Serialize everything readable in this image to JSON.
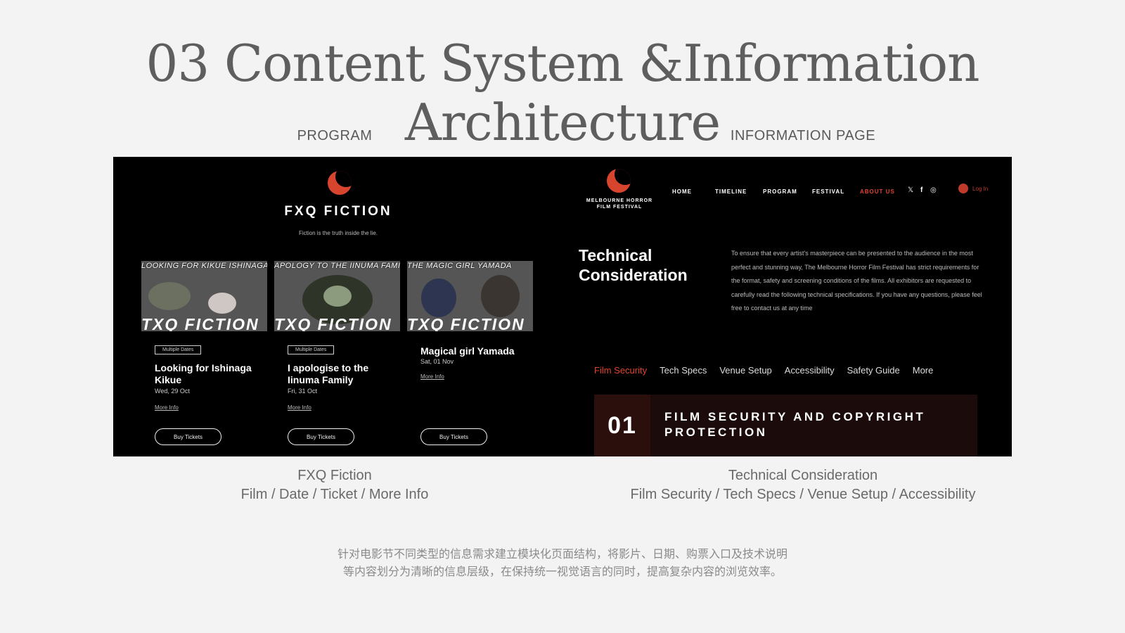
{
  "slide": {
    "title": "03 Content System &Information Architecture",
    "label_left": "PROGRAM",
    "label_right": "INFORMATION PAGE",
    "caption_left_title": "FXQ Fiction",
    "caption_left_sub": "Film / Date / Ticket / More Info",
    "caption_right_title": "Technical Consideration",
    "caption_right_sub": "Film Security / Tech Specs / Venue Setup / Accessibility",
    "note_line1": "针对电影节不同类型的信息需求建立模块化页面结构，将影片、日期、购票入口及技术说明",
    "note_line2": "等内容划分为清晰的信息层级，在保持统一视觉语言的同时，提高复杂内容的浏览效率。"
  },
  "program": {
    "brand": "FXQ FICTION",
    "tagline": "Fiction is the truth inside the lie.",
    "logo_color": "#d8452e",
    "cards": [
      {
        "thumb_top": "LOOKING FOR KIKUE ISHINAGA",
        "thumb_bottom": "TXQ FICTION",
        "badge": "Multiple Dates",
        "title": "Looking for Ishinaga Kikue",
        "date": "Wed, 29 Oct",
        "more": "More Info",
        "buy": "Buy Tickets"
      },
      {
        "thumb_top": "APOLOGY TO THE IINUMA FAMILY",
        "thumb_bottom": "TXQ FICTION",
        "badge": "Multiple Dates",
        "title": "I apologise to the Iinuma Family",
        "date": "Fri, 31 Oct",
        "more": "More Info",
        "buy": "Buy Tickets"
      },
      {
        "thumb_top": "THE MAGIC GIRL YAMADA",
        "thumb_bottom": "TXQ FICTION",
        "title": "Magical girl Yamada",
        "date": "Sat, 01 Nov",
        "more": "More Info",
        "buy": "Buy Tickets"
      }
    ]
  },
  "info": {
    "festival_name_line1": "MELBOURNE HORROR",
    "festival_name_line2": "FILM FESTIVAL",
    "nav": [
      "HOME",
      "TIMELINE",
      "PROGRAM",
      "FESTIVAL",
      "ABOUT US"
    ],
    "active_nav": "ABOUT US",
    "social_icons": [
      "x-icon",
      "facebook-icon",
      "instagram-icon"
    ],
    "social_glyphs": [
      "𝕏",
      "f",
      "◎"
    ],
    "login": "Log In",
    "heading_line1": "Technical",
    "heading_line2": "Consideration",
    "body": "To ensure that every artist's masterpiece can be presented to the audience in the most perfect and stunning way, The Melbourne Horror Film Festival has strict requirements for the format, safety and screening conditions of the films. All exhibitors are requested to carefully read the following technical specifications. If you have any questions, please feel free to contact us at any time",
    "tabs": [
      "Film Security",
      "Tech Specs",
      "Venue Setup",
      "Accessibility",
      "Safety Guide",
      "More"
    ],
    "active_tab": "Film Security",
    "section_number": "01",
    "section_title": "FILM SECURITY AND COPYRIGHT PROTECTION",
    "accent_color": "#e0452f"
  }
}
